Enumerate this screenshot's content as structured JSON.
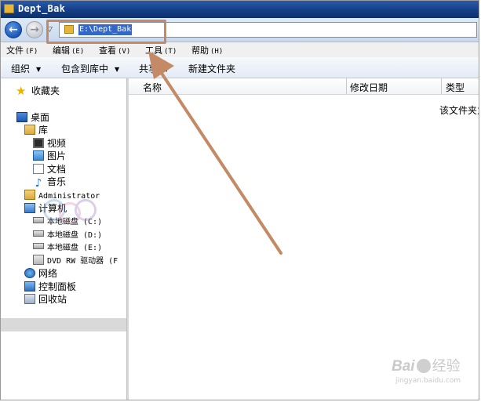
{
  "window": {
    "title": "Dept_Bak"
  },
  "address_bar": {
    "path": "E:\\Dept_Bak"
  },
  "menu": [
    {
      "label": "文件",
      "key": "(F)"
    },
    {
      "label": "编辑",
      "key": "(E)"
    },
    {
      "label": "查看",
      "key": "(V)"
    },
    {
      "label": "工具",
      "key": "(T)"
    },
    {
      "label": "帮助",
      "key": "(H)"
    }
  ],
  "toolbar": {
    "organize": "组织",
    "include_in_library": "包含到库中",
    "share": "共享",
    "new_folder": "新建文件夹"
  },
  "nav": {
    "favorites": "收藏夹",
    "desktop": "桌面",
    "libraries": "库",
    "videos": "视频",
    "pictures": "图片",
    "documents": "文档",
    "music": "音乐",
    "administrator": "Administrator",
    "computer": "计算机",
    "drive_c": "本地磁盘 (C:)",
    "drive_d": "本地磁盘 (D:)",
    "drive_e": "本地磁盘 (E:)",
    "dvd": "DVD RW 驱动器 (F",
    "network": "网络",
    "control_panel": "控制面板",
    "recycle_bin": "回收站"
  },
  "columns": {
    "name": "名称",
    "modified": "修改日期",
    "type": "类型"
  },
  "empty_message": "该文件夹为空。",
  "watermark": {
    "baidu": "Bai",
    "jingyan": "经验",
    "url": "jingyan.baidu.com"
  },
  "colors": {
    "annotation": "#c48a66",
    "selection": "#3468c8"
  }
}
